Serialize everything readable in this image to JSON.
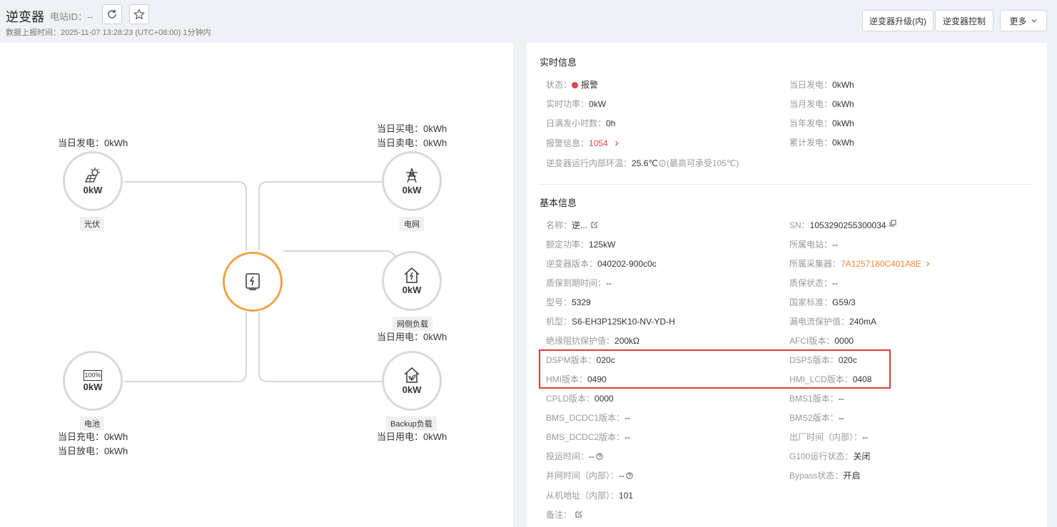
{
  "header": {
    "title": "逆变器",
    "station_id_label": "电站ID：--",
    "report_time": "数据上报时间：2025-11-07 13:28:23 (UTC+08:00) 1分钟内",
    "buttons": {
      "upgrade": "逆变器升级(内)",
      "control": "逆变器控制",
      "more": "更多"
    }
  },
  "flow": {
    "pv": {
      "label": "光伏",
      "value": "0kW",
      "stat1": "当日发电：0kWh"
    },
    "grid": {
      "label": "电网",
      "value": "0kW",
      "stat1": "当日买电：0kWh",
      "stat2": "当日卖电：0kWh"
    },
    "grid_load": {
      "label": "网侧负载",
      "value": "0kW",
      "stat1": "当日用电：0kWh"
    },
    "battery": {
      "label": "电池",
      "value": "0kW",
      "soc": "100%",
      "stat1": "当日充电：0kWh",
      "stat2": "当日放电：0kWh"
    },
    "backup_load": {
      "label": "Backup负载",
      "value": "0kW",
      "stat1": "当日用电：0kWh"
    }
  },
  "realtime": {
    "title": "实时信息",
    "left": [
      {
        "k": "状态：",
        "v": "报警"
      },
      {
        "k": "实时功率：",
        "v": "0kW"
      },
      {
        "k": "日满发小时数：",
        "v": "0h"
      },
      {
        "k": "报警信息：",
        "v": "1054"
      }
    ],
    "right": [
      {
        "k": "当日发电：",
        "v": "0kWh"
      },
      {
        "k": "当月发电：",
        "v": "0kWh"
      },
      {
        "k": "当年发电：",
        "v": "0kWh"
      },
      {
        "k": "累计发电：",
        "v": "0kWh"
      }
    ],
    "temp": {
      "k": "逆变器运行内部环温：",
      "v": "25.6℃",
      "note": "(最高可承受105℃)"
    }
  },
  "basic": {
    "title": "基本信息",
    "left": [
      {
        "k": "名称：",
        "v": "逆..."
      },
      {
        "k": "额定功率：",
        "v": "125kW"
      },
      {
        "k": "逆变器版本：",
        "v": "040202-900c0c"
      },
      {
        "k": "质保到期时间：",
        "v": "--"
      },
      {
        "k": "型号：",
        "v": "5329"
      },
      {
        "k": "机型：",
        "v": "S6-EH3P125K10-NV-YD-H"
      },
      {
        "k": "绝缘阻抗保护值：",
        "v": "200kΩ"
      },
      {
        "k": "DSPM版本：",
        "v": "020c"
      },
      {
        "k": "HMI版本：",
        "v": "0490"
      },
      {
        "k": "CPLD版本：",
        "v": "0000"
      },
      {
        "k": "BMS_DCDC1版本：",
        "v": "--"
      },
      {
        "k": "BMS_DCDC2版本：",
        "v": "--"
      },
      {
        "k": "投运时间：",
        "v": "--"
      },
      {
        "k": "并网时间（内部）：",
        "v": "--"
      },
      {
        "k": "从机地址（内部）：",
        "v": "101"
      },
      {
        "k": "备注：",
        "v": ""
      }
    ],
    "right": [
      {
        "k": "SN：",
        "v": "1053290255300034"
      },
      {
        "k": "所属电站：",
        "v": "--"
      },
      {
        "k": "所属采集器：",
        "v": "7A1257180C401A8E"
      },
      {
        "k": "质保状态：",
        "v": "--"
      },
      {
        "k": "国家标准：",
        "v": "G59/3"
      },
      {
        "k": "漏电流保护值：",
        "v": "240mA"
      },
      {
        "k": "AFCI版本：",
        "v": "0000"
      },
      {
        "k": "DSPS版本：",
        "v": "020c"
      },
      {
        "k": "HMI_LCD版本：",
        "v": "0408"
      },
      {
        "k": "BMS1版本：",
        "v": "--"
      },
      {
        "k": "BMS2版本：",
        "v": "--"
      },
      {
        "k": "出厂时间（内部）：",
        "v": "--"
      },
      {
        "k": "G100运行状态：",
        "v": "关闭"
      },
      {
        "k": "Bypass状态：",
        "v": "开启"
      }
    ]
  },
  "colors": {
    "alarm": "#e0474c",
    "link_orange": "#f0883a",
    "center_ring": "#f0a447",
    "highlight_box": "#e53935"
  }
}
